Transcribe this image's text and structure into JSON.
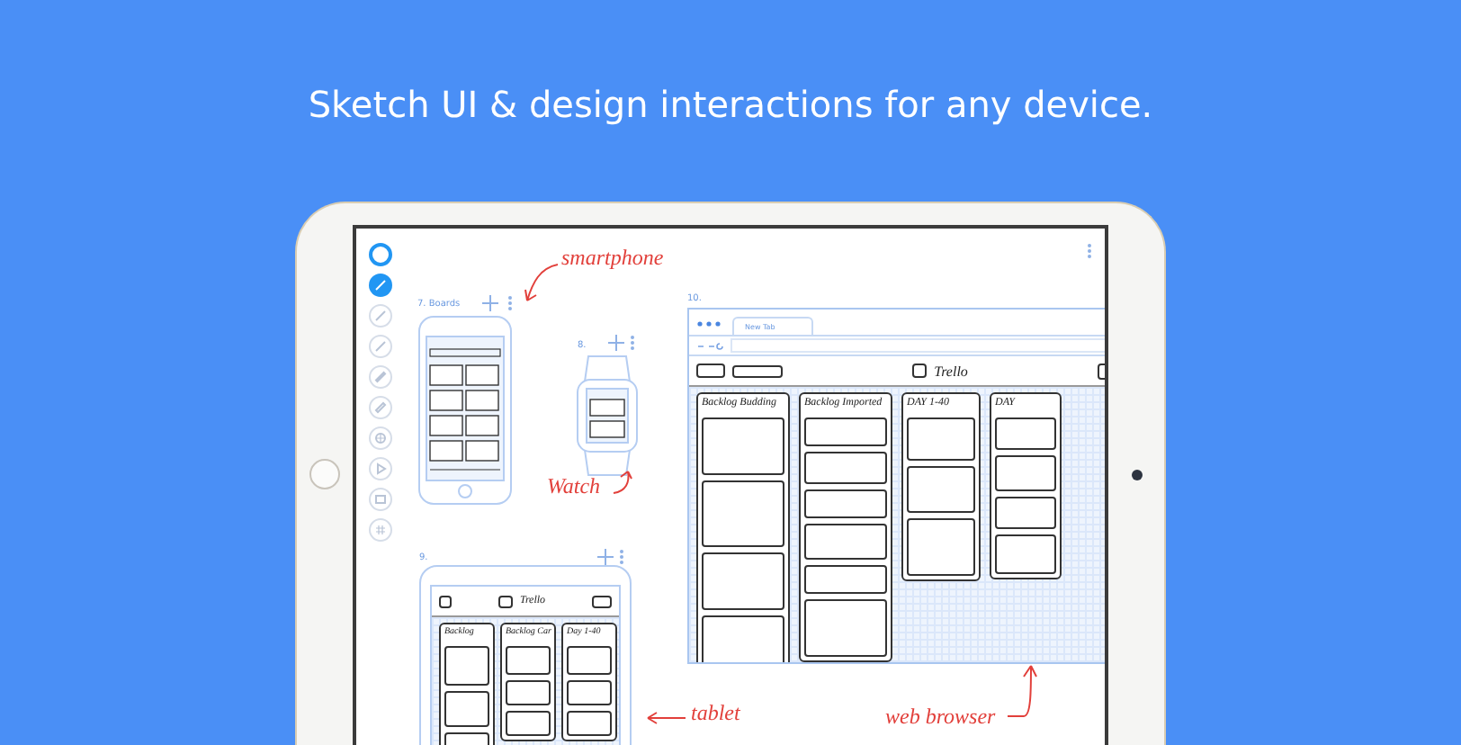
{
  "headline": "Sketch UI & design interactions for any device.",
  "tools": [
    {
      "kind": "ring",
      "selected": false
    },
    {
      "kind": "pencil",
      "selected": true
    },
    {
      "kind": "pen",
      "selected": false
    },
    {
      "kind": "pen",
      "selected": false
    },
    {
      "kind": "marker",
      "selected": false
    },
    {
      "kind": "eraser",
      "selected": false
    },
    {
      "kind": "shape",
      "selected": false
    },
    {
      "kind": "play",
      "selected": false
    },
    {
      "kind": "image",
      "selected": false
    },
    {
      "kind": "grid",
      "selected": false
    }
  ],
  "artboards": [
    {
      "kind": "phone",
      "label": "7. Boards"
    },
    {
      "kind": "watch",
      "label": "8."
    },
    {
      "kind": "browser",
      "label": "10.",
      "tab": "New Tab",
      "app_title": "Trello",
      "columns": [
        "Backlog Budding",
        "Backlog Imported",
        "DAY 1-40",
        "DAY"
      ]
    },
    {
      "kind": "tablet",
      "label": "9.",
      "app_title": "Trello",
      "columns": [
        "Backlog",
        "Backlog Car",
        "Day 1-40"
      ]
    }
  ],
  "annotations": [
    {
      "text": "smartphone"
    },
    {
      "text": "Watch"
    },
    {
      "text": "tablet"
    },
    {
      "text": "web browser"
    }
  ]
}
